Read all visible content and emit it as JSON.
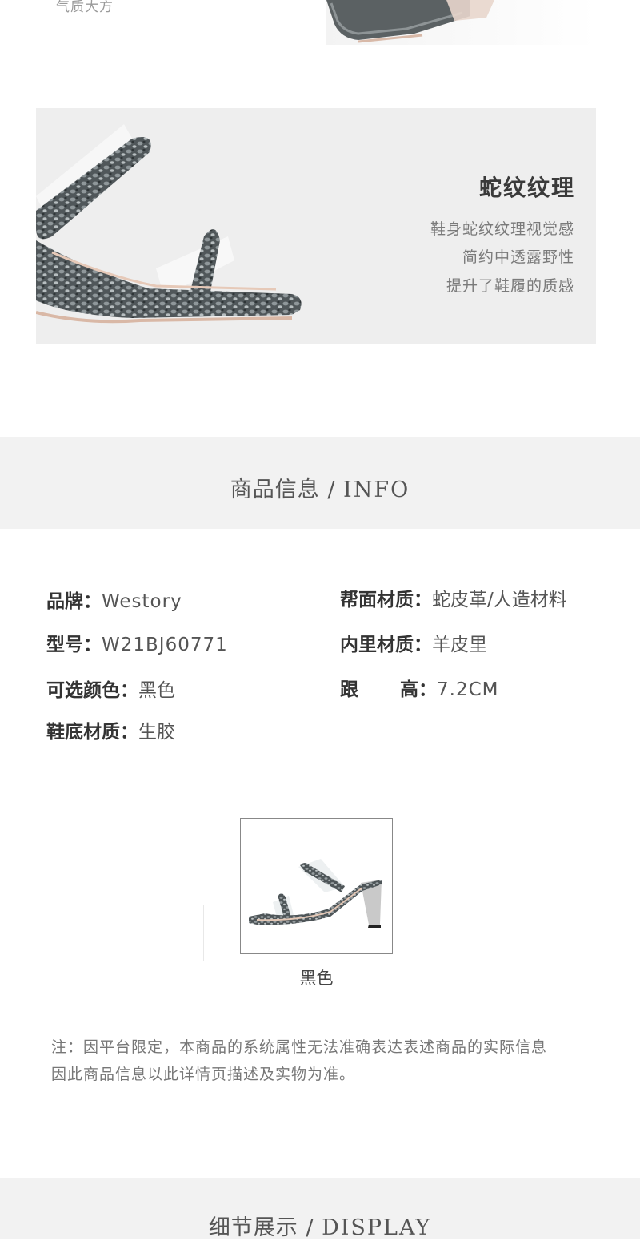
{
  "top": {
    "caption": "气质大方"
  },
  "feature": {
    "title": "蛇纹纹理",
    "lines": [
      "鞋身蛇纹纹理视觉感",
      "简约中透露野性",
      "提升了鞋履的质感"
    ]
  },
  "info_section": {
    "title_cn": "商品信息",
    "separator": " / ",
    "title_en": "INFO"
  },
  "info": {
    "brand": {
      "label": "品牌：",
      "value": "Westory"
    },
    "model": {
      "label": "型号：",
      "value": "W21BJ60771"
    },
    "color": {
      "label": "可选颜色：",
      "value": "黑色"
    },
    "sole": {
      "label": "鞋底材质：",
      "value": "生胶"
    },
    "upper": {
      "label": "帮面材质：",
      "value": "蛇皮革/人造材料"
    },
    "lining": {
      "label": "内里材质：",
      "value": "羊皮里"
    },
    "heel": {
      "label_a": "跟",
      "label_b": "高：",
      "value": "7.2CM"
    }
  },
  "swatch": {
    "label": "黑色"
  },
  "note": {
    "line1": "注：因平台限定，本商品的系统属性无法准确表达表述商品的实际信息",
    "line2": "因此商品信息以此详情页描述及实物为准。"
  },
  "display_section": {
    "title_cn": "细节展示",
    "separator": " / ",
    "title_en": "DISPLAY"
  },
  "colors": {
    "section_bg": "#f2f2f2",
    "banner_bg": "#eeeeee",
    "snake_dark": "#4a5052",
    "snake_light": "#9aa0a2"
  }
}
